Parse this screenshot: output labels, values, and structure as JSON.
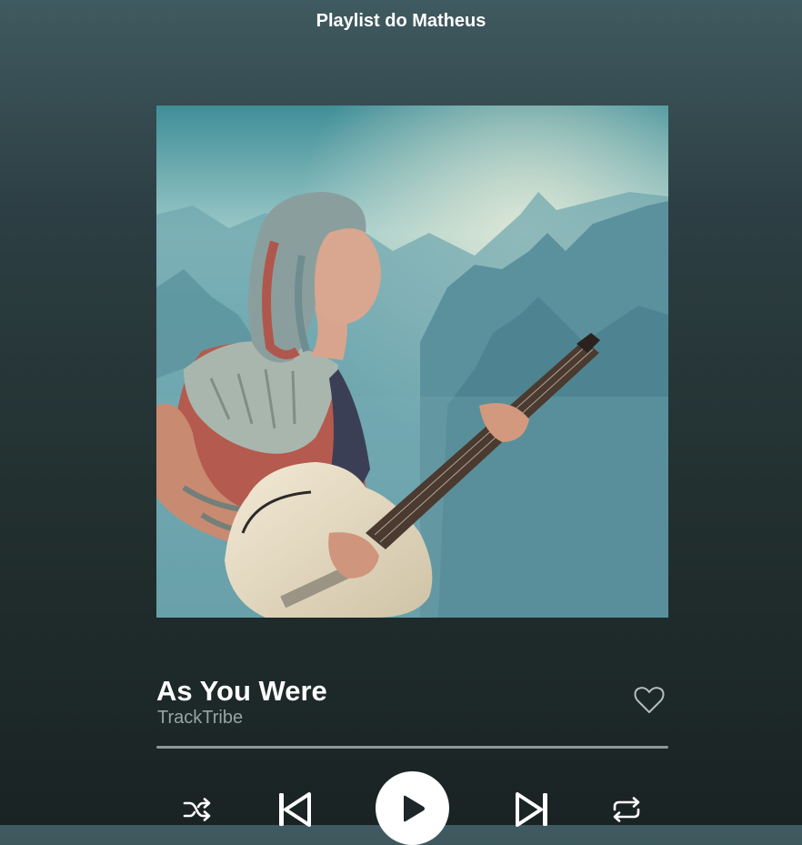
{
  "header": {
    "playlist_title": "Playlist do Matheus"
  },
  "track": {
    "title": "As You Were",
    "artist": "TrackTribe",
    "progress_fraction": 0,
    "liked": false
  },
  "controls": {
    "shuffle_icon": "shuffle-icon",
    "previous_icon": "skip-previous-icon",
    "play_icon": "play-icon",
    "next_icon": "skip-next-icon",
    "repeat_icon": "repeat-icon"
  },
  "colors": {
    "background_top": "#3f5a60",
    "background_bottom": "#1a2324",
    "artist_text": "#98a3a4",
    "progress_track": "#8d9797"
  }
}
